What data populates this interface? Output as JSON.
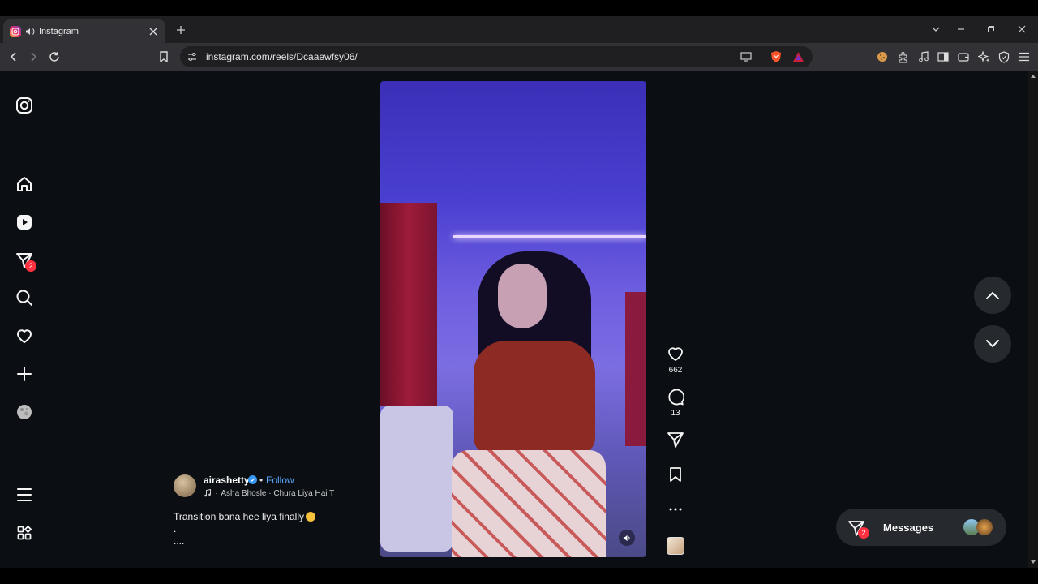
{
  "browser": {
    "tab": {
      "title": "Instagram"
    },
    "url": "instagram.com/reels/Dcaaewfsy06/"
  },
  "sidebar": {
    "messages_badge": "2"
  },
  "reel": {
    "likes": "662",
    "comments": "13",
    "author": {
      "username": "airashetty",
      "separator": "•",
      "follow_label": "Follow",
      "audio": "Asha Bhosle · Chura Liya Hai T"
    },
    "caption": {
      "line1": "Transition bana hee liya finally",
      "line2": ".",
      "line3": "...."
    }
  },
  "messages_widget": {
    "label": "Messages",
    "badge": "2"
  }
}
